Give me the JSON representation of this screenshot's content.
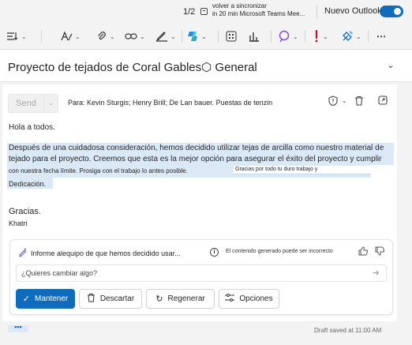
{
  "topbar": {
    "pager": "1/2",
    "reminder_line1": "volver a sincronizar",
    "reminder_line2": "in 20 min Microsoft Teams Mee...",
    "new_outlook_label": "Nuevo Outlook",
    "new_outlook_on": true
  },
  "ribbon": {
    "items": [
      "format-text-icon",
      "paint-brush-icon",
      "attach-icon",
      "link-icon",
      "signature-icon",
      "copilot-icon",
      "apps-icon",
      "insights-icon",
      "loop-icon",
      "importance-icon",
      "sensitivity-icon",
      "more-icon"
    ]
  },
  "subject": {
    "text": "Proyecto de tejados de Coral Gables⬡ General"
  },
  "compose": {
    "send_label": "Send",
    "to_line": "Para: Kevin Sturgis; Henry Brill; De Lan bauer. Puestas de tenzin",
    "greeting": "Hola a todos.",
    "para_line1": "Después de una cuidadosa consideración, hemos decidido utilizar tejas de arcilla como nuestro material de",
    "para_line2": "tejado para el proyecto. Creemos que esta es la mejor opción para asegurar el éxito del proyecto y cumplir",
    "para_line3": "con nuestra fecha límite. Prosiga con el trabajo lo antes posible.",
    "para_line3_extra": "Gracias por todo tu duro trabajo y",
    "para_line4": "Dedicación.",
    "closing": "Gracias.",
    "signature": "Khatri"
  },
  "copilot": {
    "prompt_summary": "Informe alequipo de que hemos decidido usar...",
    "disclaimer": "El contenido generado puede ser incorrecto",
    "input_placeholder": "¿Quieres cambiar algo?",
    "keep_label": "Mantener",
    "discard_label": "Descartar",
    "regenerate_label": "Regenerar",
    "options_label": "Opciones"
  },
  "footer": {
    "more_label": "•••",
    "draft_status": "Draft saved at 11:00 AM"
  },
  "colors": {
    "accent": "#0f6cbd",
    "highlight": "#dbe9f7"
  }
}
